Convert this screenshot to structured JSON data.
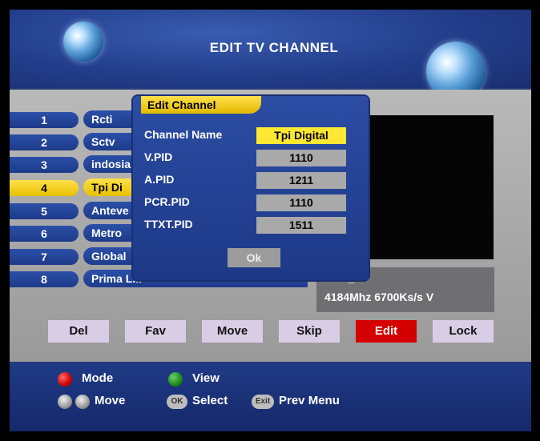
{
  "header": {
    "title": "EDIT TV CHANNEL"
  },
  "channels": [
    {
      "num": "1",
      "name": "Rcti"
    },
    {
      "num": "2",
      "name": "Sctv"
    },
    {
      "num": "3",
      "name": "indosia"
    },
    {
      "num": "4",
      "name": "Tpi Di"
    },
    {
      "num": "5",
      "name": "Anteve"
    },
    {
      "num": "6",
      "name": "Metro"
    },
    {
      "num": "7",
      "name": "Global"
    },
    {
      "num": "8",
      "name": "Prima L..."
    }
  ],
  "selected_channel": "4",
  "dialog": {
    "title": "Edit Channel",
    "fields": [
      {
        "label": "Channel Name",
        "value": "Tpi Digital"
      },
      {
        "label": "V.PID",
        "value": "1110"
      },
      {
        "label": "A.PID",
        "value": "1211"
      },
      {
        "label": "PCR.PID",
        "value": "1110"
      },
      {
        "label": "TTXT.PID",
        "value": "1511"
      }
    ],
    "ok_label": "Ok"
  },
  "info": {
    "line1": "...C2_C",
    "line2": "4184Mhz  6700Ks/s  V"
  },
  "function_buttons": [
    "Del",
    "Fav",
    "Move",
    "Skip",
    "Edit",
    "Lock"
  ],
  "active_function": "Edit",
  "footer": {
    "mode_label": "Mode",
    "view_label": "View",
    "move_label": "Move",
    "ok_key": "OK",
    "select_label": "Select",
    "exit_key": "Exit",
    "prev_menu_label": "Prev Menu"
  },
  "colors": {
    "red_key": "#d10000",
    "green_key": "#1c8a1c",
    "highlight": "#ffe14a",
    "active_button": "#d40000"
  }
}
